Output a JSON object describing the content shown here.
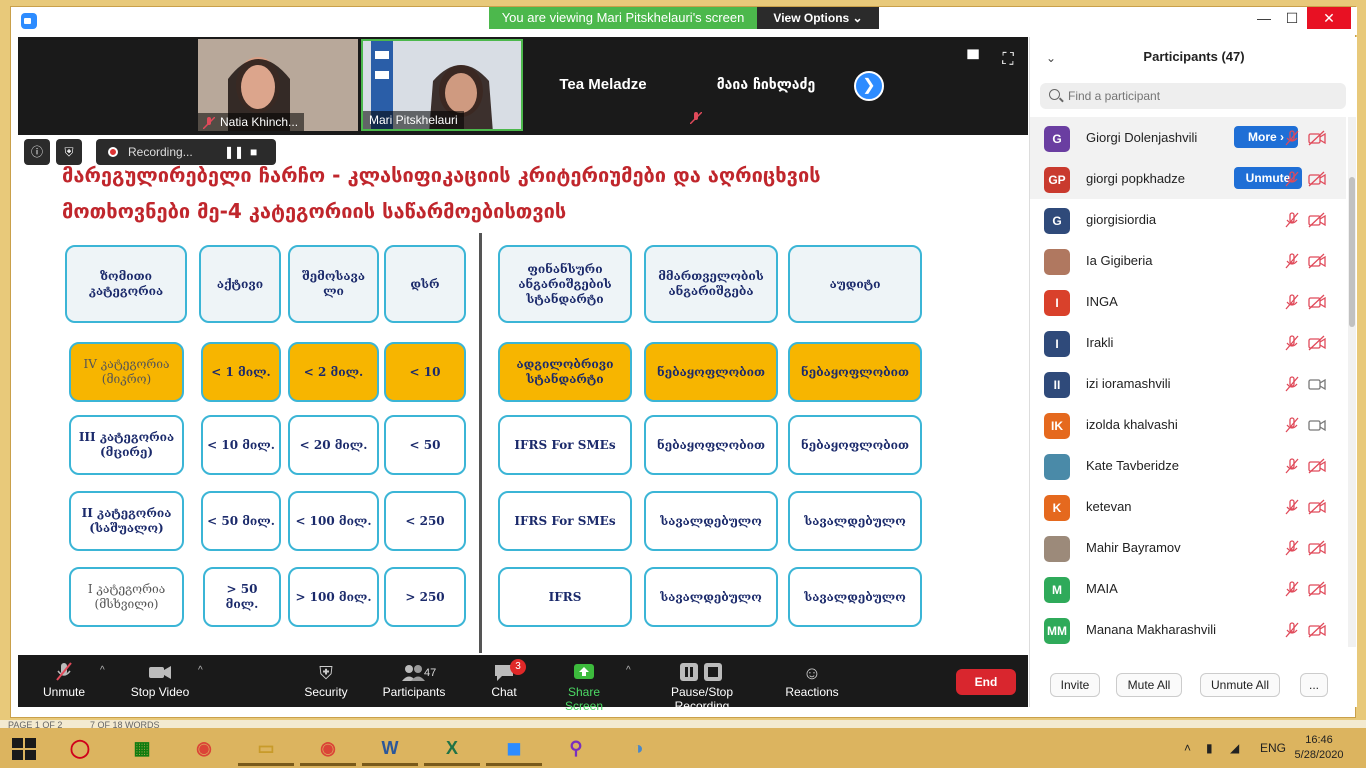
{
  "banner": {
    "viewing_text": "You are viewing Mari Pitskhelauri's screen",
    "view_options_label": "View Options"
  },
  "window": {
    "minimize_glyph": "—",
    "maximize_glyph": "☐",
    "close_glyph": "✕"
  },
  "videos": [
    {
      "name": "Natia Khinch...",
      "muted": true
    },
    {
      "name": "Mari Pitskhelauri",
      "muted": false
    }
  ],
  "name_tiles": [
    {
      "name": "Tea Meladze"
    },
    {
      "name": "მაია ჩიხლაძე"
    }
  ],
  "recording": {
    "status": "Recording..."
  },
  "slide": {
    "title": "მარეგულირებელი ჩარჩო - კლასიფიკაციის კრიტერიუმები და აღრიცხვის მოთხოვნები მე-4 კატეგორიის საწარმოებისთვის",
    "left_headers": [
      "ზომითი კატეგორია",
      "აქტივი",
      "შემოსავა ლი",
      "დსრ"
    ],
    "right_headers": [
      "ფინანსური ანგარიშგების სტანდარტი",
      "მმართველობის ანგარიშგება",
      "აუდიტი"
    ],
    "rows": [
      {
        "category": "IV კატეგორია (მიკრო)",
        "assets": "< 1 მილ.",
        "revenue": "< 2 მილ.",
        "employees": "< 10",
        "standard": "ადგილობრივი სტანდარტი",
        "management": "ნებაყოფლობით",
        "audit": "ნებაყოფლობით",
        "highlight": true
      },
      {
        "category": "III კატეგორია (მცირე)",
        "assets": "< 10 მილ.",
        "revenue": "< 20 მილ.",
        "employees": "< 50",
        "standard": "IFRS For SMEs",
        "management": "ნებაყოფლობით",
        "audit": "ნებაყოფლობით",
        "highlight": false
      },
      {
        "category": "II კატეგორია (საშუალო)",
        "assets": "< 50 მილ.",
        "revenue": "< 100 მილ.",
        "employees": "< 250",
        "standard": "IFRS For SMEs",
        "management": "სავალდებულო",
        "audit": "სავალდებულო",
        "highlight": false
      },
      {
        "category": "I კატეგორია (მსხვილი)",
        "assets": "> 50 მილ.",
        "revenue": "> 100 მილ.",
        "employees": "> 250",
        "standard": "IFRS",
        "management": "სავალდებულო",
        "audit": "სავალდებულო",
        "highlight": false
      }
    ]
  },
  "toolbar": {
    "unmute": "Unmute",
    "stop_video": "Stop Video",
    "security": "Security",
    "participants": "Participants",
    "participants_count": "47",
    "chat": "Chat",
    "chat_badge": "3",
    "share_screen": "Share Screen",
    "pause_stop_recording": "Pause/Stop Recording",
    "reactions": "Reactions",
    "end": "End"
  },
  "panel": {
    "title": "Participants (47)",
    "search_placeholder": "Find a participant",
    "participants": [
      {
        "name": "Giorgi Dolenjashvili",
        "initials": "G",
        "color": "#6a3ea1",
        "button": "More ›",
        "camera_on": false
      },
      {
        "name": "giorgi popkhadze",
        "initials": "GP",
        "color": "#c93a2e",
        "button": "Unmute",
        "camera_on": false
      },
      {
        "name": "giorgisiordia",
        "initials": "G",
        "color": "#2f4a7a",
        "button": "",
        "camera_on": false
      },
      {
        "name": "Ia Gigiberia",
        "initials": "",
        "color": "#b07860",
        "button": "",
        "camera_on": false
      },
      {
        "name": "INGA",
        "initials": "I",
        "color": "#d9412b",
        "button": "",
        "camera_on": false
      },
      {
        "name": "Irakli",
        "initials": "I",
        "color": "#2f4a7a",
        "button": "",
        "camera_on": false
      },
      {
        "name": "izi ioramashvili",
        "initials": "II",
        "color": "#2f4a7a",
        "button": "",
        "camera_on": true
      },
      {
        "name": "izolda khalvashi",
        "initials": "IK",
        "color": "#e5691e",
        "button": "",
        "camera_on": true
      },
      {
        "name": "Kate Tavberidze",
        "initials": "",
        "color": "#4a8aa8",
        "button": "",
        "camera_on": false
      },
      {
        "name": "ketevan",
        "initials": "K",
        "color": "#e5691e",
        "button": "",
        "camera_on": false
      },
      {
        "name": "Mahir Bayramov",
        "initials": "",
        "color": "#9c8a7a",
        "button": "",
        "camera_on": false
      },
      {
        "name": "MAIA",
        "initials": "M",
        "color": "#2faa5a",
        "button": "",
        "camera_on": false
      },
      {
        "name": "Manana Makharashvili",
        "initials": "MM",
        "color": "#2faa5a",
        "button": "",
        "camera_on": false
      }
    ],
    "footer": {
      "invite": "Invite",
      "mute_all": "Mute All",
      "unmute_all": "Unmute All",
      "more": "..."
    }
  },
  "status_strip": {
    "page": "PAGE 1 OF 2",
    "words": "7 OF 18 WORDS"
  },
  "taskbar": {
    "language": "ENG",
    "time": "16:46",
    "date": "5/28/2020"
  }
}
